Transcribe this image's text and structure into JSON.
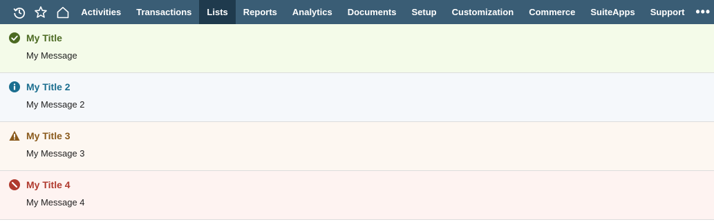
{
  "nav": {
    "icons": [
      "history-icon",
      "star-icon",
      "home-icon"
    ],
    "items": [
      {
        "label": "Activities"
      },
      {
        "label": "Transactions"
      },
      {
        "label": "Lists"
      },
      {
        "label": "Reports"
      },
      {
        "label": "Analytics"
      },
      {
        "label": "Documents"
      },
      {
        "label": "Setup"
      },
      {
        "label": "Customization"
      },
      {
        "label": "Commerce"
      },
      {
        "label": "SuiteApps"
      },
      {
        "label": "Support"
      }
    ],
    "active": "Lists",
    "more_label": "•••",
    "bg_color": "#3a5d75",
    "active_color": "#1f3a4d"
  },
  "messages": [
    {
      "type": "confirmation",
      "icon": "check-circle-icon",
      "title": "My Title",
      "body": "My Message",
      "bg": "#f4fbe9",
      "color": "#4c6a22"
    },
    {
      "type": "information",
      "icon": "info-circle-icon",
      "title": "My Title 2",
      "body": "My Message 2",
      "bg": "#f5f8fb",
      "color": "#1b6e8f"
    },
    {
      "type": "warning",
      "icon": "warning-triangle-icon",
      "title": "My Title 3",
      "body": "My Message 3",
      "bg": "#fdf7f1",
      "color": "#8a5a1c"
    },
    {
      "type": "error",
      "icon": "error-circle-icon",
      "title": "My Title 4",
      "body": "My Message 4",
      "bg": "#fef3f1",
      "color": "#b03a2e"
    }
  ]
}
